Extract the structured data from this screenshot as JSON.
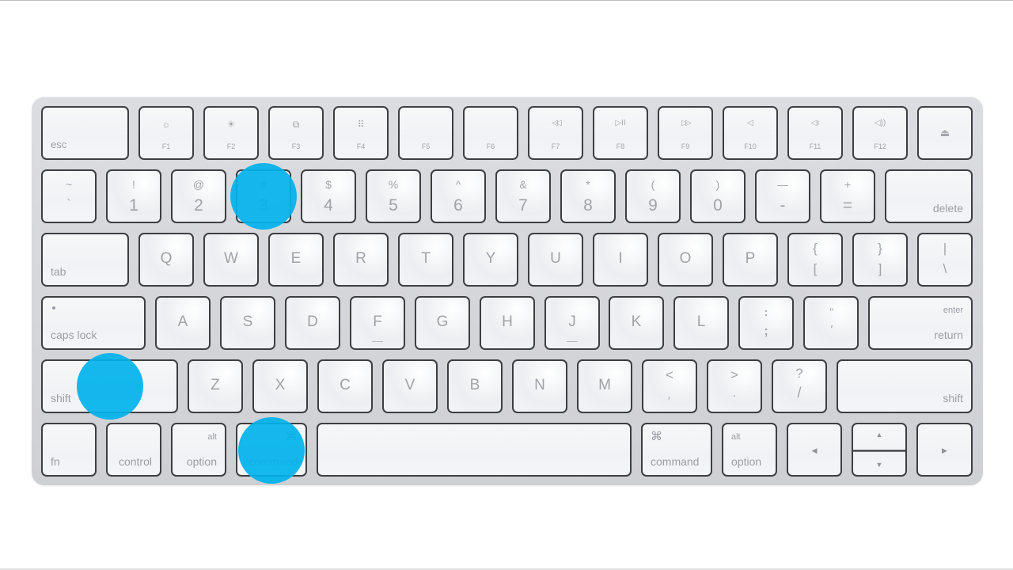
{
  "highlight_color": "#00b2ec",
  "highlighted_keys": [
    "3",
    "left shift",
    "left command"
  ],
  "function_row": [
    {
      "id": "esc",
      "label": "esc",
      "icon": ""
    },
    {
      "id": "f1",
      "label": "F1",
      "icon": "☼"
    },
    {
      "id": "f2",
      "label": "F2",
      "icon": "☀"
    },
    {
      "id": "f3",
      "label": "F3",
      "icon": "⧉"
    },
    {
      "id": "f4",
      "label": "F4",
      "icon": "⠿"
    },
    {
      "id": "f5",
      "label": "F5",
      "icon": ""
    },
    {
      "id": "f6",
      "label": "F6",
      "icon": ""
    },
    {
      "id": "f7",
      "label": "F7",
      "icon": "◁◁"
    },
    {
      "id": "f8",
      "label": "F8",
      "icon": "▷II"
    },
    {
      "id": "f9",
      "label": "F9",
      "icon": "▷▷"
    },
    {
      "id": "f10",
      "label": "F10",
      "icon": "◁"
    },
    {
      "id": "f11",
      "label": "F11",
      "icon": "◁ı"
    },
    {
      "id": "f12",
      "label": "F12",
      "icon": "◁))"
    },
    {
      "id": "eject",
      "label": "",
      "icon": "⏏"
    }
  ],
  "number_row": [
    {
      "shift": "~",
      "base": "`"
    },
    {
      "shift": "!",
      "base": "1"
    },
    {
      "shift": "@",
      "base": "2"
    },
    {
      "shift": "#",
      "base": "3"
    },
    {
      "shift": "$",
      "base": "4"
    },
    {
      "shift": "%",
      "base": "5"
    },
    {
      "shift": "^",
      "base": "6"
    },
    {
      "shift": "&",
      "base": "7"
    },
    {
      "shift": "*",
      "base": "8"
    },
    {
      "shift": "(",
      "base": "9"
    },
    {
      "shift": ")",
      "base": "0"
    },
    {
      "shift": "—",
      "base": "-"
    },
    {
      "shift": "+",
      "base": "="
    }
  ],
  "delete_label": "delete",
  "tab_label": "tab",
  "qwerty_row": [
    "Q",
    "W",
    "E",
    "R",
    "T",
    "Y",
    "U",
    "I",
    "O",
    "P"
  ],
  "bracket_keys": [
    {
      "shift": "{",
      "base": "["
    },
    {
      "shift": "}",
      "base": "]"
    },
    {
      "shift": "|",
      "base": "\\"
    }
  ],
  "caps_lock_label": "caps lock",
  "home_row": [
    "A",
    "S",
    "D",
    "F",
    "G",
    "H",
    "J",
    "K",
    "L"
  ],
  "home_row_punct": [
    {
      "shift": ":",
      "base": ";"
    },
    {
      "shift": "\"",
      "base": "'"
    }
  ],
  "return_label": "return",
  "enter_label": "enter",
  "shift_label": "shift",
  "bottom_letter_row": [
    "Z",
    "X",
    "C",
    "V",
    "B",
    "N",
    "M"
  ],
  "bottom_punct": [
    {
      "shift": "<",
      "base": ","
    },
    {
      "shift": ">",
      "base": "."
    },
    {
      "shift": "?",
      "base": "/"
    }
  ],
  "modifier_row": {
    "fn": "fn",
    "control": "control",
    "alt": "alt",
    "option": "option",
    "command_symbol": "⌘",
    "command": "command",
    "left_arrow": "◀",
    "up_arrow": "▲",
    "down_arrow": "▼",
    "right_arrow": "▶"
  }
}
